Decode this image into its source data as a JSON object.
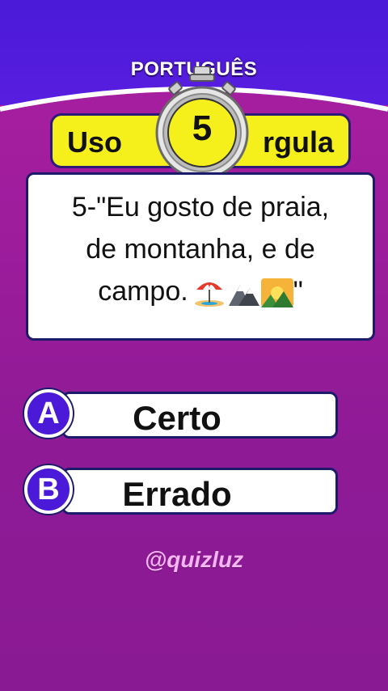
{
  "header": {
    "subject": "PORTUGUÊS"
  },
  "topic": {
    "left_text": "Uso",
    "right_text": "rgula"
  },
  "timer": {
    "number": "5"
  },
  "question": {
    "line1": "5-\"Eu gosto de praia,",
    "line2": "de montanha, e de",
    "line3_text": "campo.",
    "line3_end": "\"",
    "emojis": [
      "beach-umbrella-icon",
      "mountain-icon",
      "sunrise-over-mountains-icon"
    ]
  },
  "answers": [
    {
      "letter": "A",
      "label": "Certo"
    },
    {
      "letter": "B",
      "label": "Errado"
    }
  ],
  "watermark": "@quizluz",
  "colors": {
    "top_band": "#4a1ad8",
    "background": "#9a1a9a",
    "banner_yellow": "#f5f01c",
    "border_navy": "#1c1a6a",
    "letter_circle": "#4a1ad8"
  }
}
